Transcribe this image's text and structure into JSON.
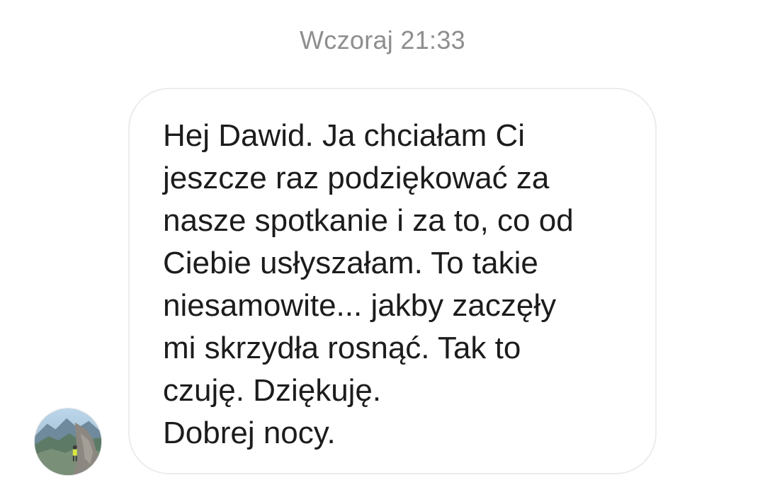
{
  "chat": {
    "timestamp": "Wczoraj 21:33",
    "message": {
      "lines": [
        "Hej Dawid. Ja chciałam Ci",
        "jeszcze raz podziękować za",
        "nasze spotkanie i za to, co od",
        "Ciebie usłyszałam. To takie",
        "niesamowite... jakby zaczęły",
        "mi skrzydła rosnąć. Tak to",
        "czuję. Dziękuję.",
        "Dobrej nocy."
      ]
    },
    "sender": {
      "avatar_icon": "mountain-photo-avatar"
    }
  },
  "colors": {
    "background": "#ffffff",
    "timestamp_text": "#8e8e8e",
    "bubble_border": "#ececec",
    "message_text": "#1c1c1c"
  }
}
